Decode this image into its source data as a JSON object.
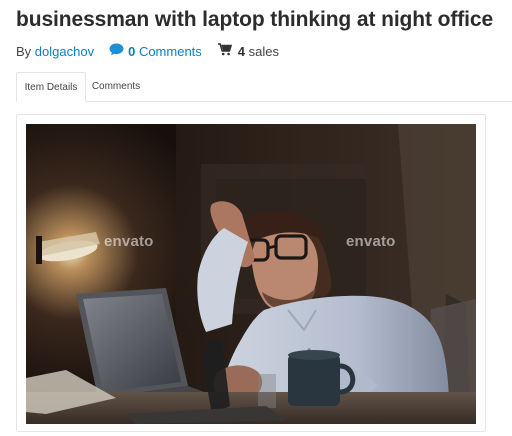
{
  "item": {
    "title": "businessman with laptop thinking at night office",
    "by_label": "By",
    "author": "dolgachov",
    "comments_count": "0",
    "comments_label": "Comments",
    "sales_count": "4",
    "sales_label": "sales"
  },
  "tabs": [
    {
      "label": "Item Details",
      "active": true
    },
    {
      "label": "Comments",
      "active": false
    }
  ],
  "preview": {
    "watermark": "envato",
    "description": "businessman with laptop thinking at night office"
  },
  "colors": {
    "link": "#0a7fc4",
    "title": "#2c2c2c",
    "border": "#e4e4e4"
  },
  "icons": {
    "comment": "speech-bubble",
    "sales": "shopping-cart"
  }
}
